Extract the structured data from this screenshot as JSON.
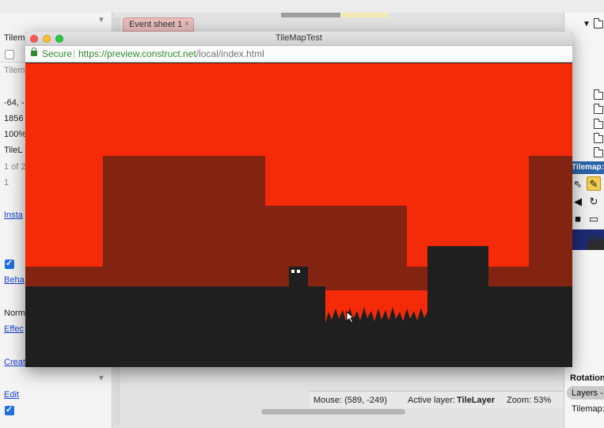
{
  "editor": {
    "left_panel": {
      "rows": [
        "Tilem",
        "Tilem",
        "-64, -",
        "1856",
        "100%",
        "TileL",
        "1 of 2",
        "1",
        "Insta",
        "Beha",
        "Norm",
        "Effec",
        "Creat",
        "Edit"
      ],
      "checkboxes": [
        false,
        true,
        true
      ]
    },
    "event_tab": {
      "label": "Event sheet 1",
      "close": "×"
    },
    "status": {
      "mouse": "Mouse: (589, -249)",
      "active_layer_label": "Active layer:",
      "active_layer_value": "TileLayer",
      "zoom": "Zoom: 53%"
    },
    "right_panel": {
      "tilemap_header": "Tilemap:",
      "rotation_label": "Rotation",
      "layers_tab": "Layers -",
      "tilemap_label": "Tilemap:"
    }
  },
  "browser": {
    "title": "TileMapTest",
    "secure_label": "Secure",
    "url_host": "https://preview.construct.net",
    "url_path": "/local/index.html"
  },
  "colors": {
    "sky": "#f42a09",
    "background_hills": "#832312",
    "ground": "#1f1f1f",
    "tilemap_toolbar_active": "#f0cd52",
    "tilemap_header": "#2a63a8",
    "secure_green": "#2f8a2f",
    "event_tab": "#e8bcbc"
  }
}
